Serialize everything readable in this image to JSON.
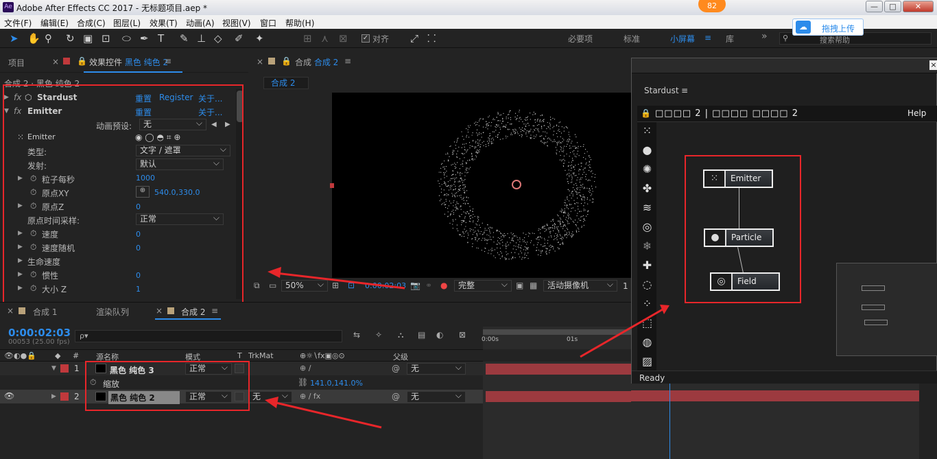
{
  "window": {
    "app_icon": "Ae",
    "title": "Adobe After Effects CC 2017 - 无标题项目.aep *",
    "badge": "82",
    "minimize": "—",
    "maximize": "□",
    "close": "✕"
  },
  "menu": [
    "文件(F)",
    "编辑(E)",
    "合成(C)",
    "图层(L)",
    "效果(T)",
    "动画(A)",
    "视图(V)",
    "窗口",
    "帮助(H)"
  ],
  "toolbar": {
    "align_label": "对齐",
    "workspaces": [
      "必要项",
      "标准",
      "小屏幕",
      "库"
    ],
    "search_placeholder": "搜索帮助",
    "upload_label": "拖拽上传"
  },
  "effects_panel": {
    "tab_project": "项目",
    "tab_effects_prefix": "效果控件",
    "tab_effects_layer": "黑色 纯色 2",
    "breadcrumb": "合成 2 · 黑色 纯色 2",
    "stardust": {
      "name": "Stardust",
      "reset": "重置",
      "register": "Register",
      "about": "关于..."
    },
    "emitter": {
      "name": "Emitter",
      "reset": "重置",
      "about": "关于...",
      "preset_label": "动画预设:",
      "preset_value": "无",
      "sub_label": "Emitter"
    },
    "props": [
      {
        "label": "类型:",
        "value": "文字 / 遮罩"
      },
      {
        "label": "发射:",
        "value": "默认"
      },
      {
        "label": "粒子每秒",
        "value": "1000"
      },
      {
        "label": "原点XY",
        "value": "540.0,330.0"
      },
      {
        "label": "原点Z",
        "value": "0"
      },
      {
        "label": "原点时间采样:",
        "value": "正常"
      },
      {
        "label": "速度",
        "value": "0"
      },
      {
        "label": "速度随机",
        "value": "0"
      },
      {
        "label": "生命速度",
        "value": ""
      },
      {
        "label": "惯性",
        "value": "0"
      },
      {
        "label": "大小 Z",
        "value": "1"
      }
    ]
  },
  "comp_panel": {
    "tab_label": "合成",
    "tab_comp": "合成 2",
    "sub_tab": "合成 2",
    "zoom": "50%",
    "timecode": "0:00:02:03",
    "quality": "完整",
    "camera": "活动摄像机",
    "views": "1"
  },
  "stardust_panel": {
    "title": "Stardust",
    "header_left": "□□□□ 2 | □□□□ □□□□ 2",
    "help": "Help",
    "status": "Ready",
    "nodes": [
      {
        "name": "Emitter",
        "icon": "emitter-dots"
      },
      {
        "name": "Particle",
        "icon": "circle"
      },
      {
        "name": "Field",
        "icon": "target"
      }
    ]
  },
  "tabs_bottom": {
    "tab1": "合成 1",
    "tab2": "渲染队列",
    "tab3": "合成 2"
  },
  "timeline": {
    "timecode": "0:00:02:03",
    "frames": "00053 (25.00 fps)",
    "search_placeholder": "ρ▾",
    "headers": {
      "num": "#",
      "source": "源名称",
      "mode": "模式",
      "t": "T",
      "trkmat": "TrkMat",
      "parent": "父级"
    },
    "ruler": [
      "0:00s",
      "01s"
    ],
    "layers": [
      {
        "num": "1",
        "name": "黑色 纯色 3",
        "mode": "正常",
        "trkmat": "",
        "parent": "无"
      },
      {
        "num": "2",
        "name": "黑色 纯色 2",
        "mode": "正常",
        "trkmat": "无",
        "parent": "无"
      }
    ],
    "scale": {
      "label": "缩放",
      "value": "141.0,141.0%"
    }
  },
  "colors": {
    "accent": "#2d8ceb",
    "highlight_red": "#e8262a",
    "layer_bar": "#9c3a3f",
    "label_red": "#c0393c"
  }
}
